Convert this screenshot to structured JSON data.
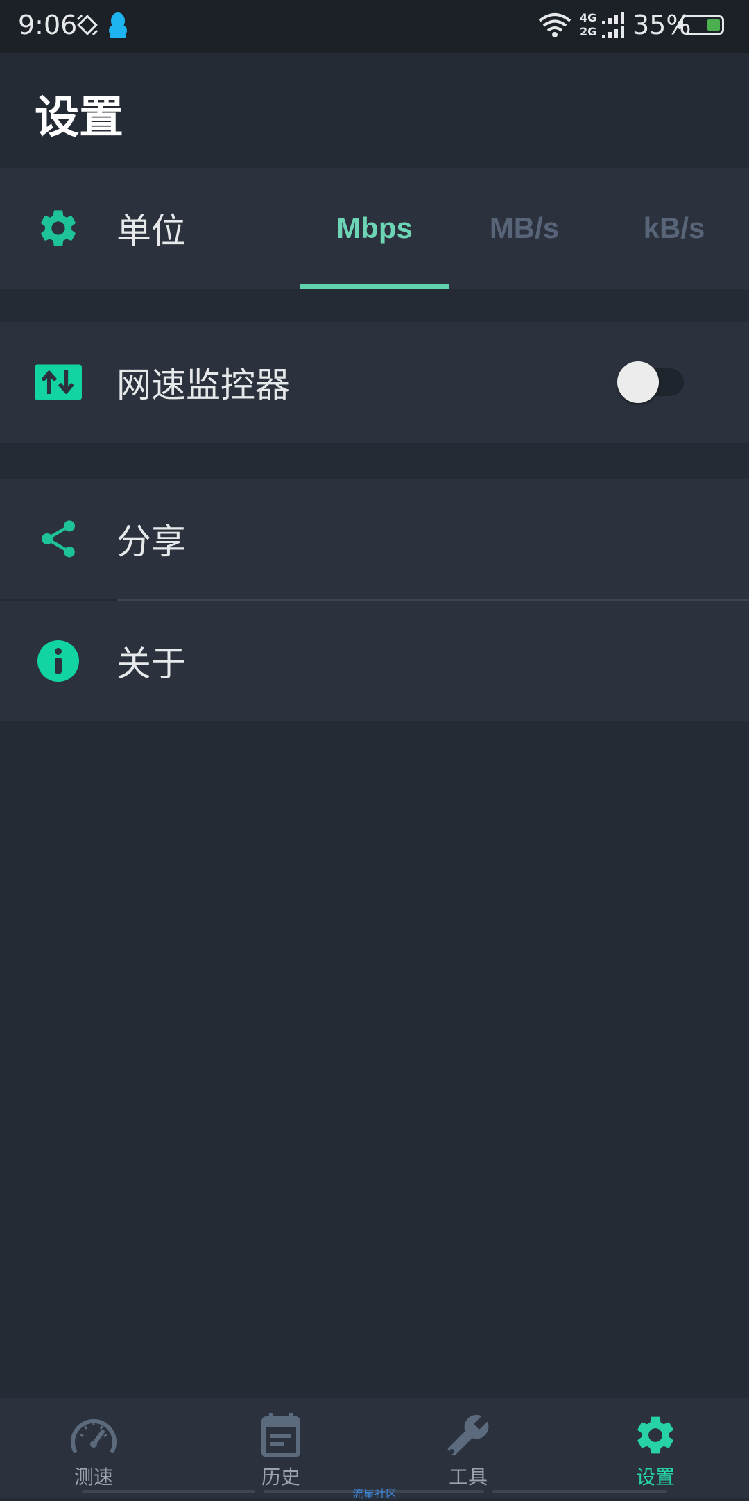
{
  "status_bar": {
    "time": "9:06",
    "network_top": "4G",
    "network_bottom": "2G",
    "battery_percent": "35%",
    "battery_level": 0.35
  },
  "header": {
    "title": "设置"
  },
  "settings": {
    "unit": {
      "label": "单位",
      "options": [
        "Mbps",
        "MB/s",
        "kB/s"
      ],
      "selected": "Mbps"
    },
    "monitor": {
      "label": "网速监控器",
      "enabled": false
    },
    "share": {
      "label": "分享"
    },
    "about": {
      "label": "关于"
    }
  },
  "bottom_nav": {
    "items": [
      {
        "label": "测速",
        "icon": "speedometer-icon"
      },
      {
        "label": "历史",
        "icon": "calendar-icon"
      },
      {
        "label": "工具",
        "icon": "wrench-icon"
      },
      {
        "label": "设置",
        "icon": "gear-icon"
      }
    ],
    "active": "设置"
  },
  "watermark": "流星社区",
  "colors": {
    "accent": "#27d3a6",
    "background": "#252b35",
    "card": "#2b323d",
    "inactive": "#586478"
  }
}
